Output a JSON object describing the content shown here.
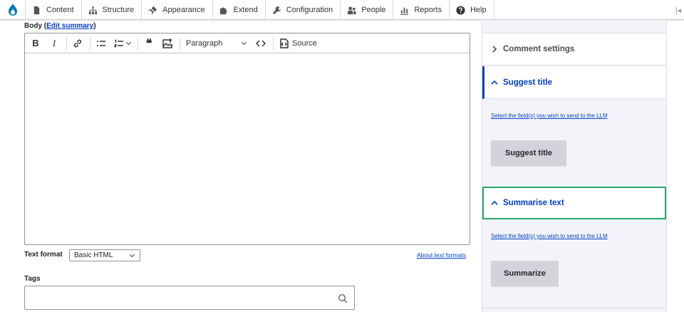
{
  "toolbar": {
    "items": [
      {
        "label": "Content",
        "icon": "file-icon"
      },
      {
        "label": "Structure",
        "icon": "sitemap-icon"
      },
      {
        "label": "Appearance",
        "icon": "brush-icon"
      },
      {
        "label": "Extend",
        "icon": "puzzle-icon"
      },
      {
        "label": "Configuration",
        "icon": "wrench-icon"
      },
      {
        "label": "People",
        "icon": "people-icon"
      },
      {
        "label": "Reports",
        "icon": "bar-chart-icon"
      },
      {
        "label": "Help",
        "icon": "help-icon"
      }
    ],
    "drupal_color": "#0678be"
  },
  "body_field": {
    "label": "Body (",
    "edit_summary": "Edit summary",
    "label_end": ")",
    "heading_select": "Paragraph",
    "source_label": "Source"
  },
  "text_format": {
    "label": "Text format",
    "value": "Basic HTML",
    "about_link": "About text formats"
  },
  "tags": {
    "label": "Tags",
    "value": ""
  },
  "sidebar": {
    "comment_settings": "Comment settings",
    "suggest_title": {
      "heading": "Suggest title",
      "link": "Select the field(s) you wish to send to the LLM",
      "button": "Suggest title"
    },
    "summarise_text": {
      "heading": "Summarise text",
      "link": "Select the field(s) you wish to send to the LLM",
      "button": "Summarize"
    }
  },
  "colors": {
    "link": "#003ecc",
    "focus_outline": "#26a769",
    "sidebar_bg": "#f3f4f9"
  }
}
